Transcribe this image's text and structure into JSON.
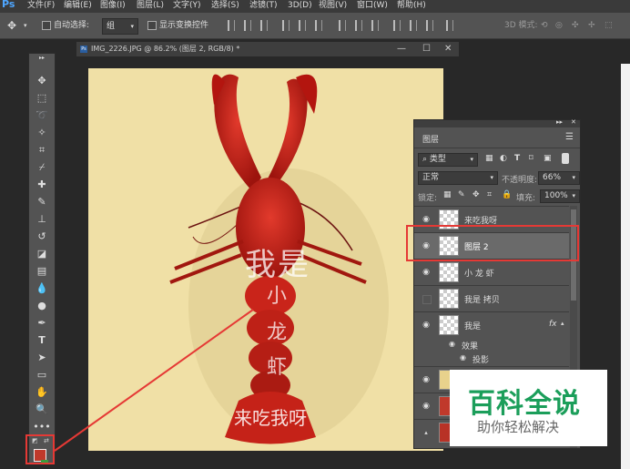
{
  "menu": {
    "logo": "Ps",
    "items": [
      "文件(F)",
      "编辑(E)",
      "图像(I)",
      "图层(L)",
      "文字(Y)",
      "选择(S)",
      "滤镜(T)",
      "3D(D)",
      "视图(V)",
      "窗口(W)",
      "帮助(H)"
    ]
  },
  "options": {
    "auto_select_label": "自动选择:",
    "auto_select_value": "组",
    "show_transform_label": "显示变换控件",
    "mode_3d": "3D 模式:"
  },
  "document": {
    "tab_title": "IMG_2226.JPG @ 86.2% (图层 2, RGB/8) *",
    "canvas_texts": {
      "woshi": "我是",
      "xiao": "小",
      "long": "龙",
      "xia": "虾",
      "laichi": "来吃我呀"
    }
  },
  "layers_panel": {
    "title": "图层",
    "filter_label": "类型",
    "blend_mode": "正常",
    "opacity_label": "不透明度:",
    "opacity_value": "66%",
    "lock_label": "锁定:",
    "fill_label": "填充:",
    "fill_value": "100%",
    "layers": [
      {
        "name": "来吃我呀",
        "visible": true
      },
      {
        "name": "图层 2",
        "visible": true,
        "selected": true
      },
      {
        "name": "小 龙 虾",
        "visible": true
      },
      {
        "name": "我是 拷贝",
        "visible": false
      },
      {
        "name": "我是",
        "visible": true,
        "fx": "fx"
      }
    ],
    "effects_label": "效果",
    "drop_shadow_label": "投影"
  },
  "watermark": {
    "title": "百科全说",
    "subtitle": "助你轻松解决"
  },
  "colors": {
    "highlight": "#e53935",
    "foreground_swatch": "#c0392b",
    "canvas_bg": "#f0e0a6",
    "watermark_green": "#1b9e5a"
  }
}
